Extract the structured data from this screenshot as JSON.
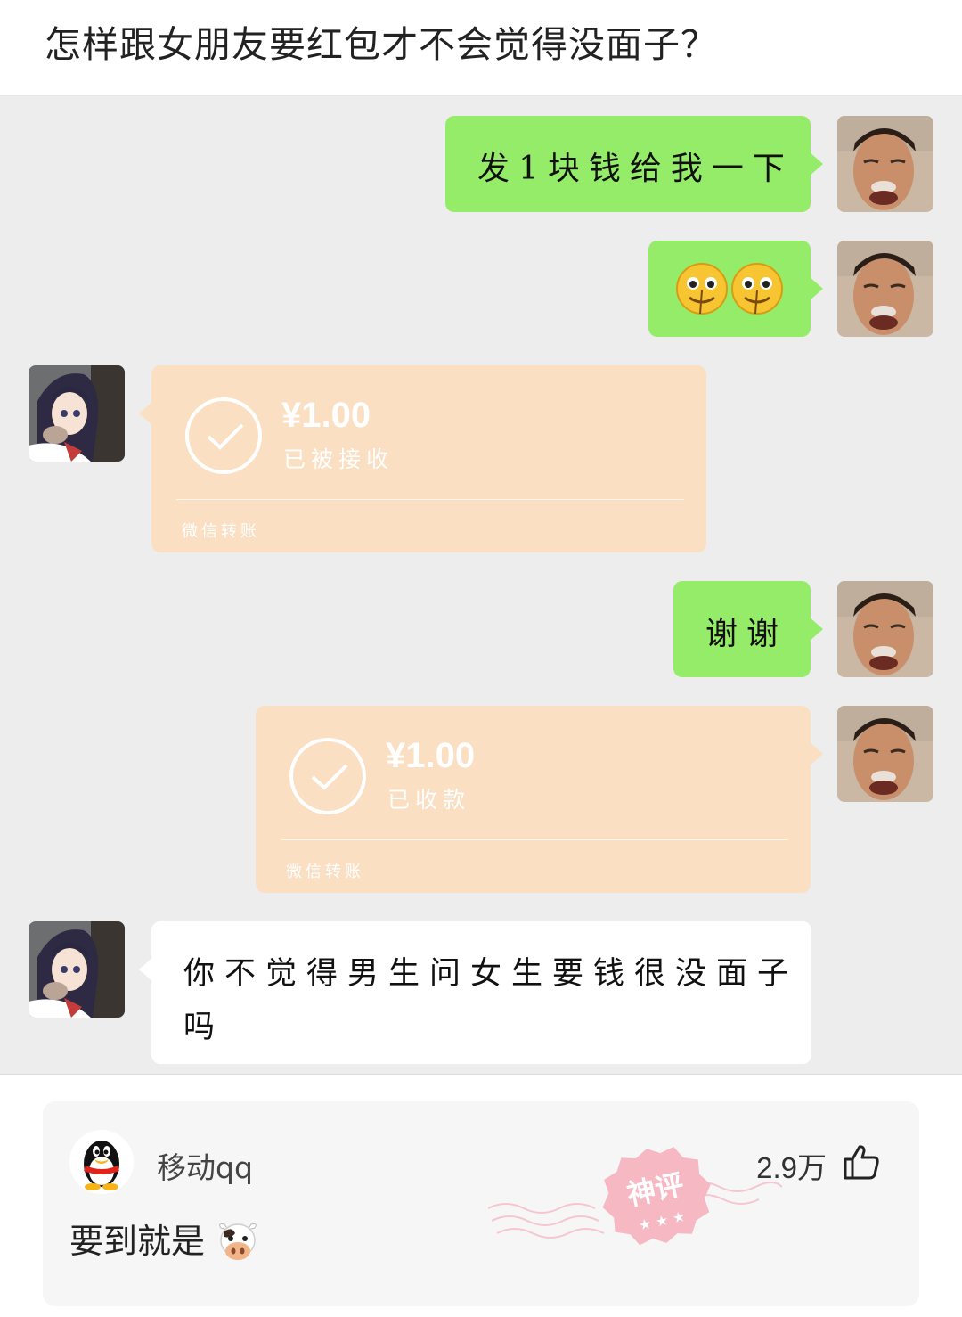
{
  "title": "怎样跟女朋友要红包才不会觉得没面子？",
  "messages": [
    {
      "side": "right",
      "type": "text",
      "text": "发1块钱给我一下"
    },
    {
      "side": "right",
      "type": "emoji",
      "emoji_names": [
        "smile-emoji",
        "smile-emoji"
      ]
    },
    {
      "side": "left",
      "type": "transfer",
      "amount": "¥1.00",
      "status": "已被接收",
      "footer": "微信转账"
    },
    {
      "side": "right",
      "type": "text",
      "text": "谢谢"
    },
    {
      "side": "right",
      "type": "transfer",
      "amount": "¥1.00",
      "status": "已收款",
      "footer": "微信转账"
    },
    {
      "side": "left",
      "type": "text",
      "text_line1": "你不觉得男生问女生要钱很没面子",
      "text_line2": "吗"
    }
  ],
  "comment": {
    "username": "移动qq",
    "likes": "2.9万",
    "content": "要到就是",
    "badge": "神评",
    "content_emoji": "cow-emoji"
  },
  "colors": {
    "chat_bg": "#ededed",
    "green_bubble": "#95ec69",
    "transfer_bubble": "#fbdfc2",
    "badge_pink": "#f6b8c3"
  }
}
